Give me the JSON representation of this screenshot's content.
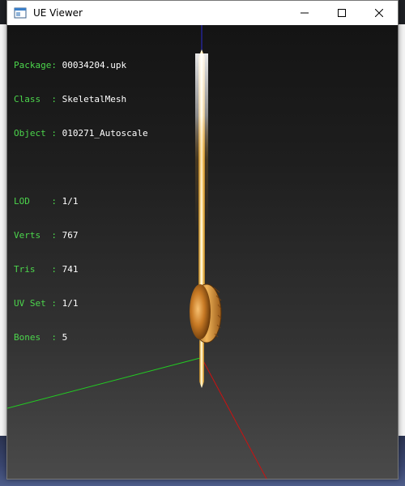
{
  "window": {
    "title": "UE Viewer"
  },
  "info": {
    "package": {
      "label": "Package:",
      "value": "00034204.upk"
    },
    "class": {
      "label": "Class  :",
      "value": "SkeletalMesh"
    },
    "object": {
      "label": "Object :",
      "value": "010271_Autoscale"
    },
    "lod": {
      "label": "LOD    :",
      "value": "1/1"
    },
    "verts": {
      "label": "Verts  :",
      "value": "767"
    },
    "tris": {
      "label": "Tris   :",
      "value": "741"
    },
    "uvset": {
      "label": "UV Set :",
      "value": "1/1"
    },
    "bones": {
      "label": "Bones  :",
      "value": "5"
    }
  },
  "colors": {
    "label_green": "#4cd64c",
    "axis_x": "#cc1111",
    "axis_y": "#22cc22",
    "axis_z": "#2222cc",
    "mesh_gold": "#e0a040"
  },
  "icons": {
    "app": "window-app-icon",
    "minimize": "minimize-icon",
    "maximize": "maximize-icon",
    "close": "close-icon"
  }
}
